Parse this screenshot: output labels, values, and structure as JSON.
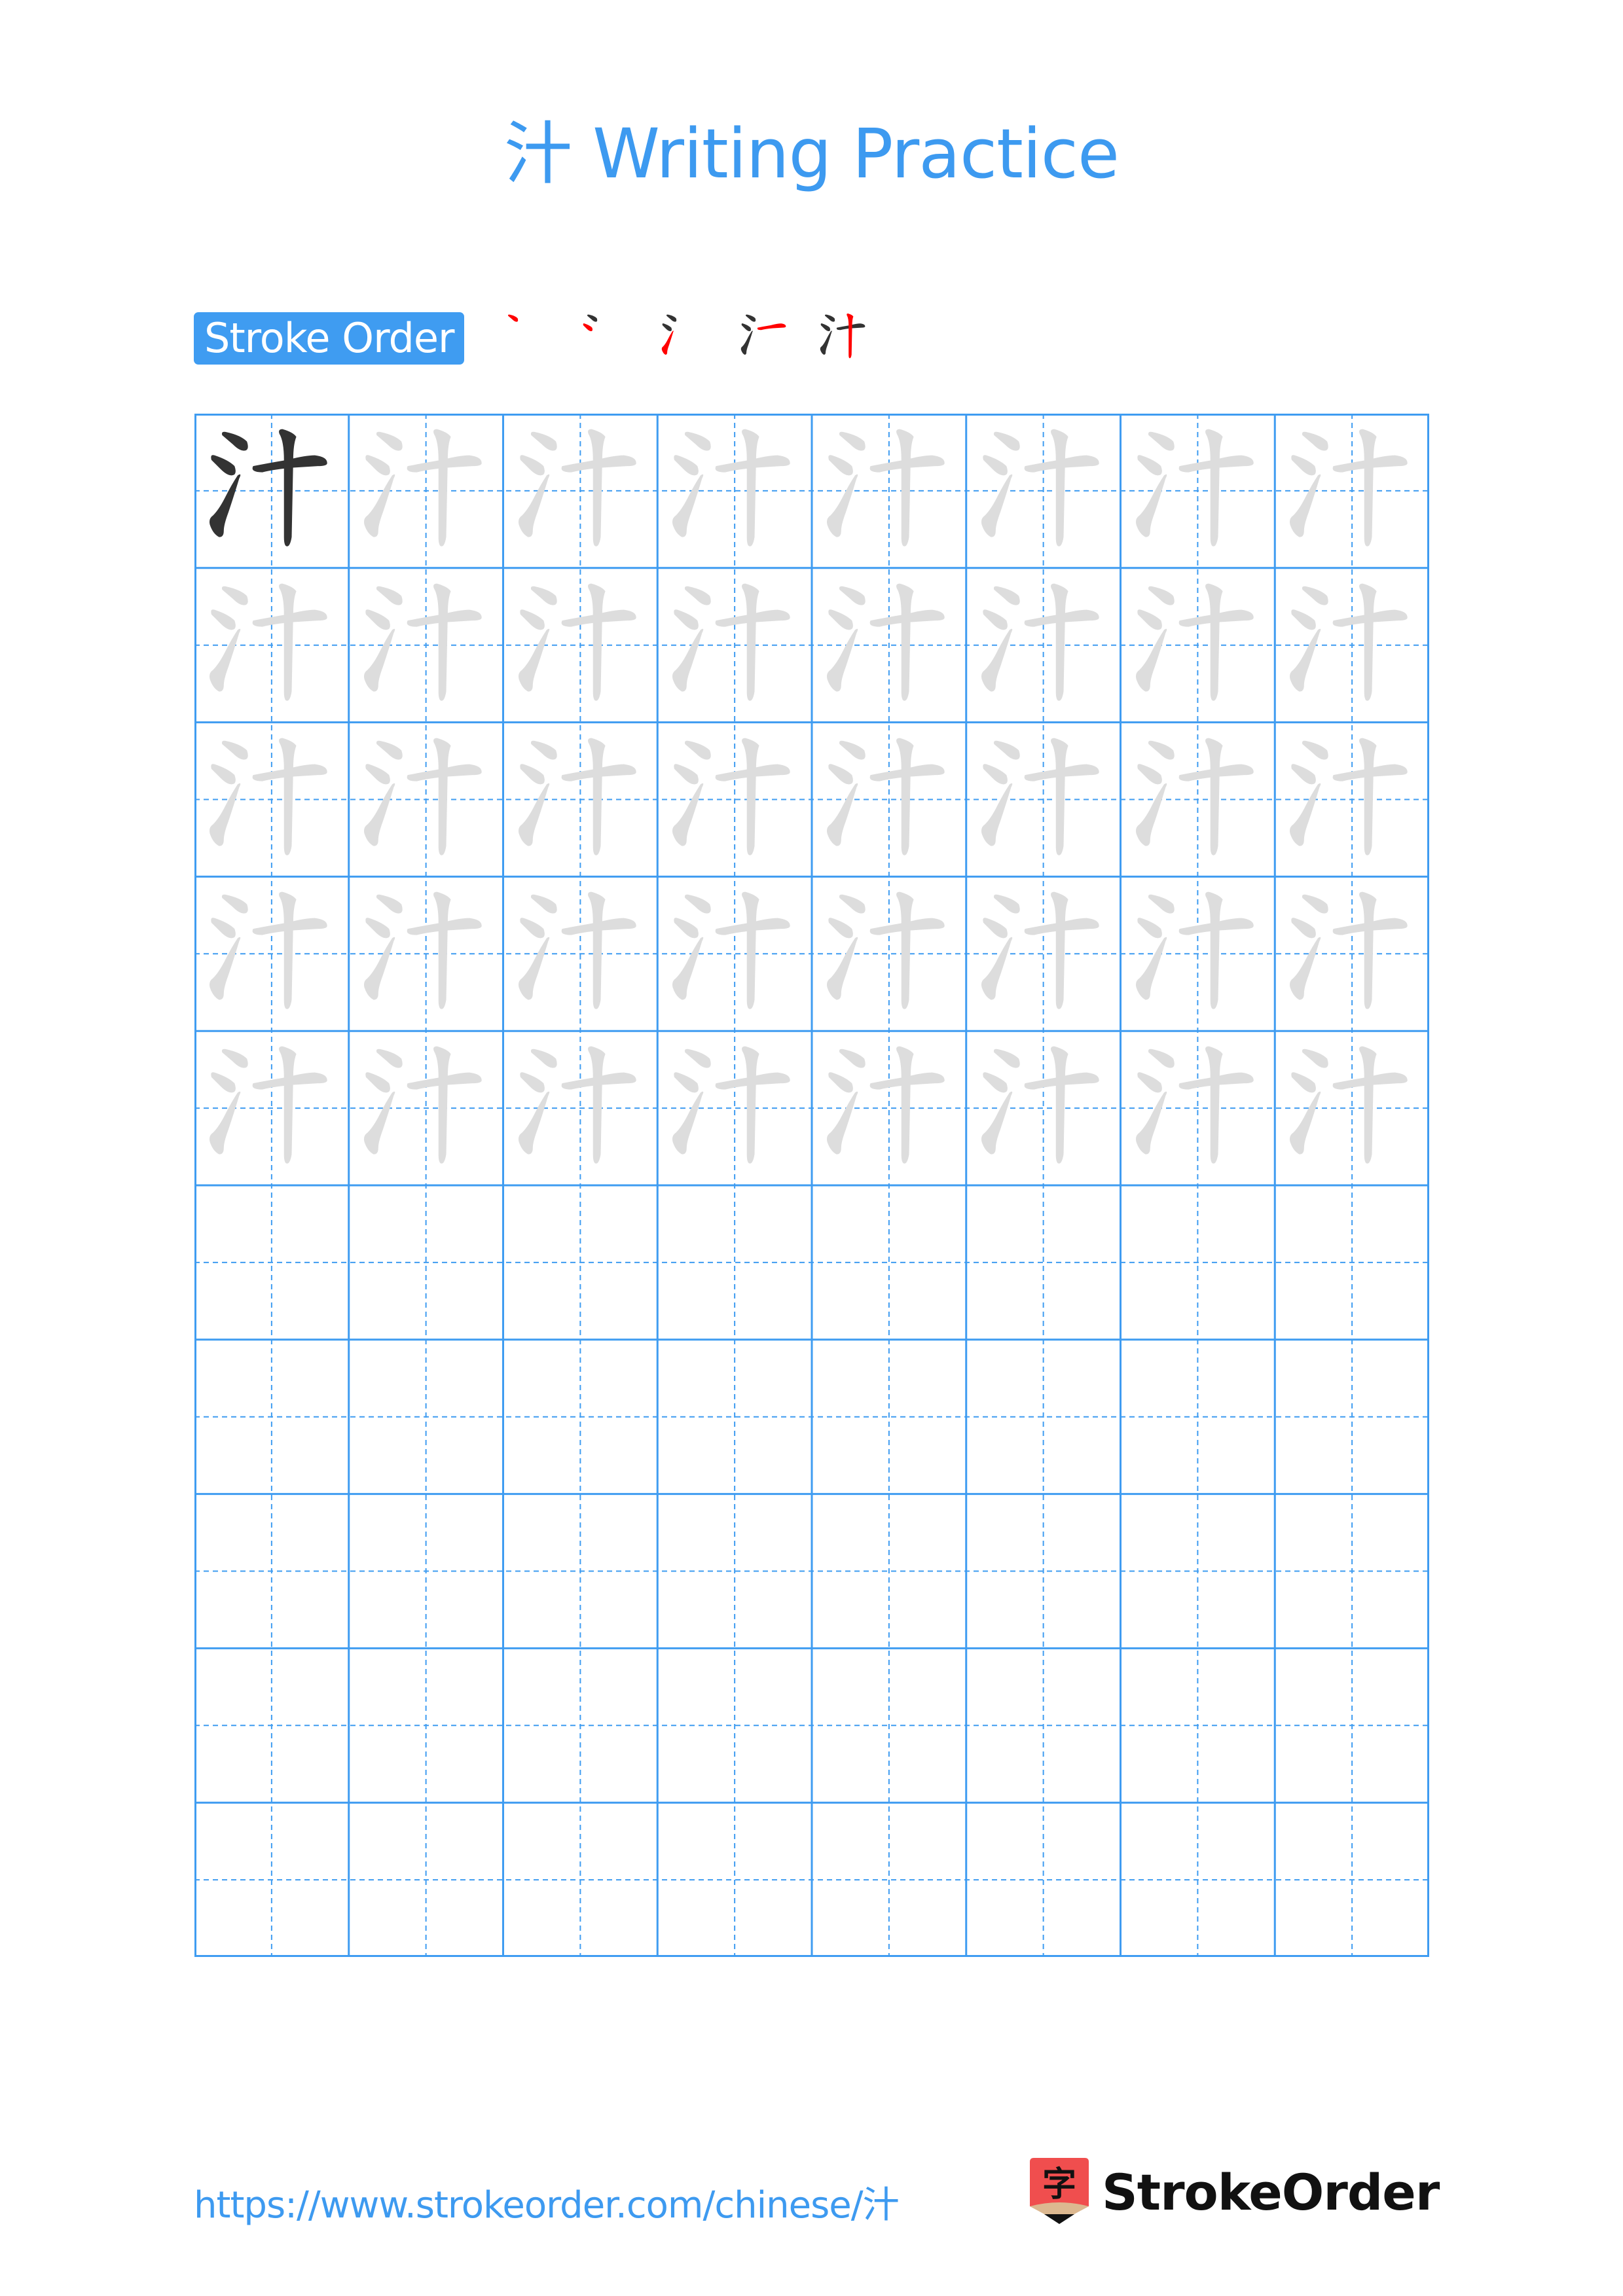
{
  "page": {
    "title": "汁 Writing Practice",
    "character": "汁"
  },
  "stroke_order": {
    "label": "Stroke Order",
    "total_strokes": 5,
    "steps": [
      1,
      2,
      3,
      4,
      5
    ],
    "highlight_color": "#ff0000",
    "done_color": "#333333"
  },
  "grid": {
    "columns": 8,
    "rows": 10,
    "solid_reference_cells": 1,
    "traced_rows": 5,
    "empty_rows": 5,
    "line_color": "#3f9cf1",
    "solid_char_color": "#333333",
    "trace_char_color": "#dddddd"
  },
  "footer": {
    "url": "https://www.strokeorder.com/chinese/汁",
    "brand": "StrokeOrder",
    "logo_glyph": "字",
    "logo_color": "#f04e4e"
  }
}
